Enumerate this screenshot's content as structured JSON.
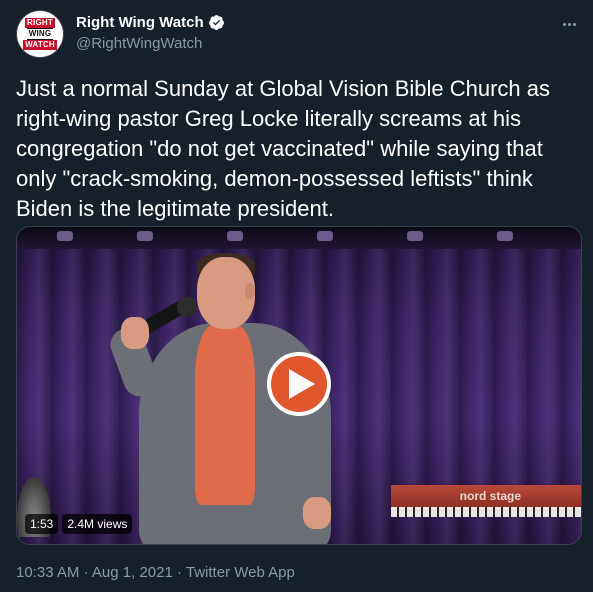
{
  "account": {
    "display_name": "Right Wing Watch",
    "handle": "@RightWingWatch",
    "logo_lines": [
      "RIGHT",
      "WING",
      "WATCH"
    ],
    "verified": true,
    "verified_icon": "verified-badge-icon"
  },
  "tweet": {
    "text": "Just a normal Sunday at Global Vision Bible Church as right-wing pastor Greg Locke literally screams at his congregation \"do not get vaccinated\" while saying that only \"crack-smoking, demon-possessed leftists\" think Biden is the legitimate president.",
    "more_icon": "more-options-icon"
  },
  "media": {
    "duration": "1:53",
    "views": "2.4M views",
    "overlay_text": "nord stage",
    "play_icon": "play-icon"
  },
  "meta": {
    "time": "10:33 AM",
    "separator": "·",
    "date": "Aug 1, 2021",
    "source": "Twitter Web App"
  },
  "colors": {
    "background": "#15202b",
    "text_primary": "#ffffff",
    "text_secondary": "#8899a6",
    "verified_blue": "#1d9bf0",
    "play_button": "#e0572e"
  }
}
